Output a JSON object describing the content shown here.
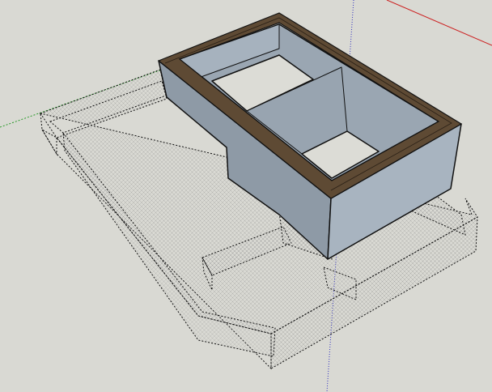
{
  "viewport": {
    "background_color": "#d9d9d3",
    "axis_colors": {
      "red": "#cc2020",
      "green": "#2a9a2a",
      "blue": "#3030c0"
    },
    "wall_color": "#9aa6b2",
    "frame_color": "#5a4630",
    "icons": [
      "model-3d",
      "axes"
    ]
  }
}
